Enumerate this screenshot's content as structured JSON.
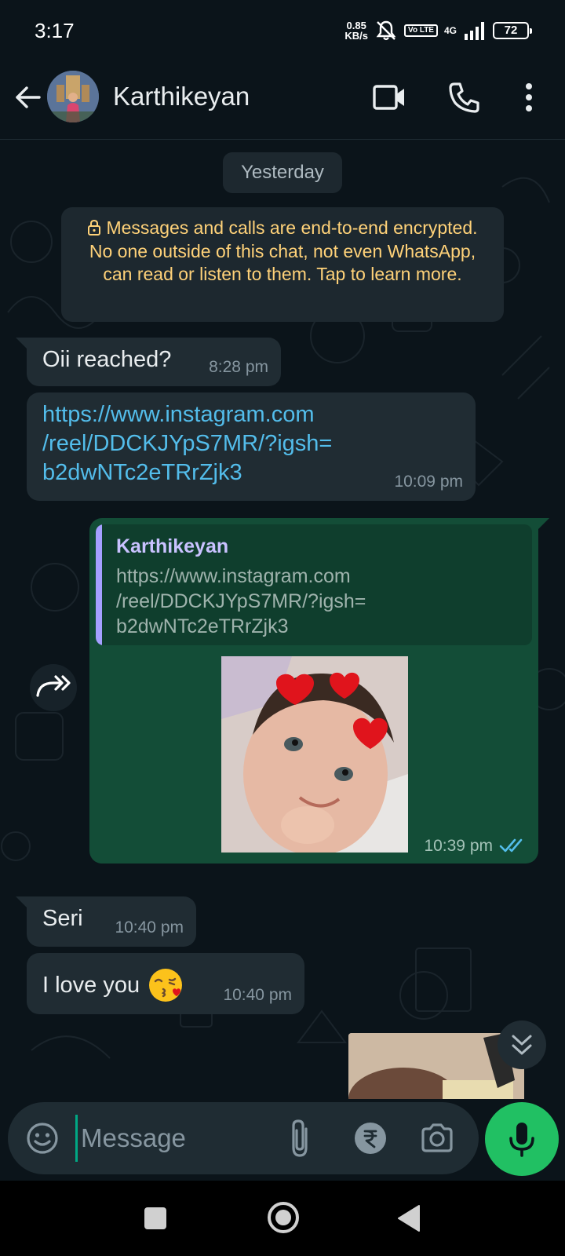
{
  "status_bar": {
    "time": "3:17",
    "net_speed_value": "0.85",
    "net_speed_unit": "KB/s",
    "volte": "Vo LTE",
    "network": "4G",
    "battery": "72"
  },
  "header": {
    "contact_name": "Karthikeyan",
    "icons": [
      "back-arrow-icon",
      "video-call-icon",
      "voice-call-icon",
      "more-options-icon"
    ]
  },
  "chat": {
    "date_chip": "Yesterday",
    "encryption_notice": "Messages and calls are end-to-end encrypted. No one outside of this chat, not even WhatsApp, can read or listen to them. Tap to learn more.",
    "messages": [
      {
        "direction": "in",
        "text": "Oii reached?",
        "time": "8:28 pm"
      },
      {
        "direction": "in",
        "link_lines": [
          "https://www.instagram.com",
          "/reel/DDCKJYpS7MR/?igsh=",
          "b2dwNTc2eTRrZjk3"
        ],
        "time": "10:09 pm"
      },
      {
        "direction": "out",
        "quote_author": "Karthikeyan",
        "quote_lines": [
          "https://www.instagram.com",
          "/reel/DDCKJYpS7MR/?igsh=",
          "b2dwNTc2eTRrZjk3"
        ],
        "time": "10:39 pm",
        "status": "read"
      },
      {
        "direction": "in",
        "text": "Seri",
        "time": "10:40 pm"
      },
      {
        "direction": "in",
        "text": "I love you",
        "emoji": "kissing-face-emoji",
        "time": "10:40 pm"
      }
    ]
  },
  "input": {
    "placeholder": "Message"
  },
  "colors": {
    "background": "#0b141a",
    "incoming_bubble": "#202c33",
    "outgoing_bubble": "#134d37",
    "link": "#53bdeb",
    "encryption_text": "#ffd279",
    "accent_green": "#21c063",
    "read_ticks": "#53bdeb"
  }
}
